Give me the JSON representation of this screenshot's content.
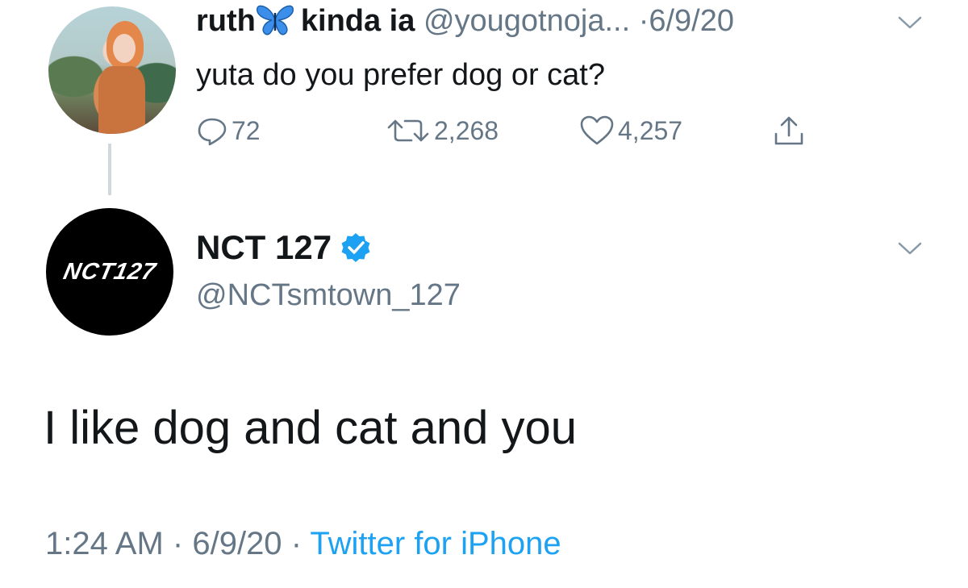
{
  "parent_tweet": {
    "display_name_start": "ruth",
    "display_name_end": "kinda ia",
    "handle": "@yougotnoja...",
    "date": "·6/9/20",
    "text": "yuta do you prefer dog or cat?",
    "actions": {
      "replies": "72",
      "retweets": "2,268",
      "likes": "4,257"
    }
  },
  "reply_tweet": {
    "display_name": "NCT 127",
    "handle": "@NCTsmtown_127",
    "avatar_text": "NCT127",
    "text": "I like dog and cat and you",
    "time": "1:24 AM",
    "date": "6/9/20",
    "separator": "·",
    "source": "Twitter for iPhone"
  },
  "colors": {
    "text_primary": "#14171a",
    "text_secondary": "#657786",
    "link": "#1da1f2",
    "verified": "#1da1f2",
    "butterfly": "#3b8eea"
  },
  "icons": {
    "reply": "speech-bubble",
    "retweet": "retweet-arrows",
    "like": "heart-outline",
    "share": "share-up-arrow",
    "menu": "chevron-down",
    "verified": "verified-check",
    "emoji": "blue-butterfly"
  }
}
